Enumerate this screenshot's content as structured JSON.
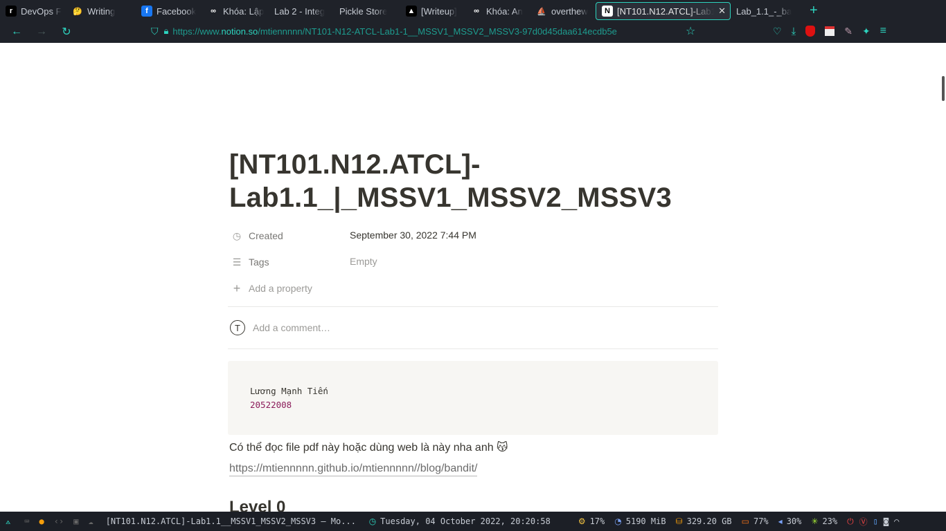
{
  "browser": {
    "tabs": [
      {
        "label": "DevOps F",
        "icon": "devops-icon",
        "fav": "r",
        "favbg": "#000000"
      },
      {
        "label": "Writing",
        "icon": "thinking-emoji-icon",
        "fav": "🤔",
        "favbg": "transparent"
      },
      {
        "label": "Facebook",
        "icon": "facebook-icon",
        "fav": "f",
        "favbg": "#1877f2"
      },
      {
        "label": "Khóa: Lập",
        "icon": "moodle-icon",
        "fav": "∞",
        "favbg": "transparent"
      },
      {
        "label": "Lab 2 - Integ",
        "icon": "",
        "fav": "",
        "favbg": "transparent"
      },
      {
        "label": "Pickle Store",
        "icon": "",
        "fav": "",
        "favbg": "transparent"
      },
      {
        "label": "[Writeup]",
        "icon": "writeup-icon",
        "fav": "▲",
        "favbg": "#000000"
      },
      {
        "label": "Khóa: An",
        "icon": "moodle-icon",
        "fav": "∞",
        "favbg": "transparent"
      },
      {
        "label": "overthew",
        "icon": "overthewire-icon",
        "fav": "⛵",
        "favbg": "transparent"
      },
      {
        "label": "[NT101.N12.ATCL]-Lab1",
        "icon": "notion-icon",
        "fav": "N",
        "favbg": "#ffffff",
        "active": true
      },
      {
        "label": "Lab_1.1_-_ba",
        "icon": "",
        "fav": "",
        "favbg": "transparent"
      }
    ],
    "url_prefix": "https://www.",
    "url_domain": "notion.so",
    "url_path": "/mtiennnnn/NT101-N12-ATCL-Lab1-1__MSSV1_MSSV2_MSSV3-97d0d45daa614ecdb5e"
  },
  "page": {
    "title": "[NT101.N12.ATCL]-Lab1.1_|_MSSV1_MSSV2_MSSV3",
    "properties": {
      "created_label": "Created",
      "created_value": "September 30, 2022 7:44 PM",
      "tags_label": "Tags",
      "tags_value": "Empty",
      "add_property": "Add a property"
    },
    "comment_avatar": "T",
    "comment_placeholder": "Add a comment…",
    "code": {
      "line1": "Lương Mạnh Tiến",
      "line2": "20522008"
    },
    "paragraph": "Có thể đọc file pdf này hoặc dùng web là này nha anh 😽",
    "link": "https://mtiennnnn.github.io/mtiennnnn//blog/bandit/",
    "heading": "Level 0"
  },
  "statusbar": {
    "window_title": "[NT101.N12.ATCL]-Lab1.1__MSSV1_MSSV2_MSSV3 — Mo...",
    "datetime": "Tuesday, 04 October 2022, 20:20:58",
    "cpu": "17%",
    "mem": "5190 MiB",
    "disk": "329.20 GB",
    "battery": "77%",
    "volume": "30%",
    "brightness": "23%"
  }
}
